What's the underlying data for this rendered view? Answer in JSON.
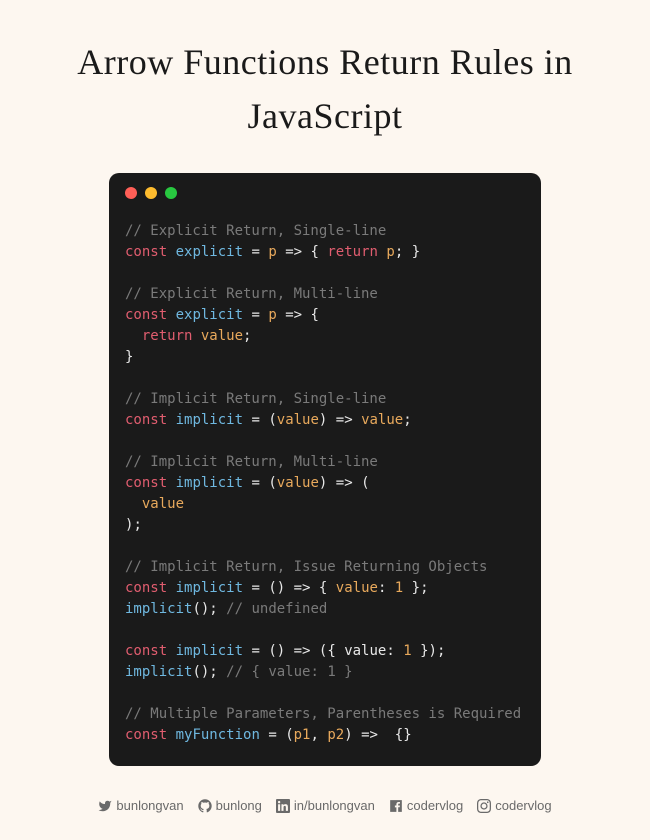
{
  "title": "Arrow Functions Return Rules in JavaScript",
  "code": {
    "c1": "// Explicit Return, Single-line",
    "kw": "const",
    "f_explicit": "explicit",
    "eq": " = ",
    "p_p": "p",
    "arrow": " => ",
    "brace_o": "{",
    "brace_c": "}",
    "ret": "return",
    "semi": ";",
    "c2": "// Explicit Return, Multi-line",
    "v_value": "value",
    "c3": "// Implicit Return, Single-line",
    "f_implicit": "implicit",
    "paren_o": "(",
    "paren_c": ")",
    "c4": "// Implicit Return, Multi-line",
    "c5": "// Implicit Return, Issue Returning Objects",
    "colon": ": ",
    "num1": "1",
    "call": "();",
    "c_undef": "// undefined",
    "c_obj": "// { value: 1 }",
    "obj_open": "({ ",
    "obj_close": " });",
    "value_plain": "value",
    "c6": "// Multiple Parameters, Parentheses is Required",
    "f_my": "myFunction",
    "p1": "p1",
    "p2": "p2",
    "comma": ", ",
    "empty_body": " {}"
  },
  "socials": [
    {
      "icon": "twitter",
      "handle": "bunlongvan"
    },
    {
      "icon": "github",
      "handle": "bunlong"
    },
    {
      "icon": "linkedin",
      "handle": "in/bunlongvan"
    },
    {
      "icon": "facebook",
      "handle": "codervlog"
    },
    {
      "icon": "instagram",
      "handle": "codervlog"
    }
  ]
}
